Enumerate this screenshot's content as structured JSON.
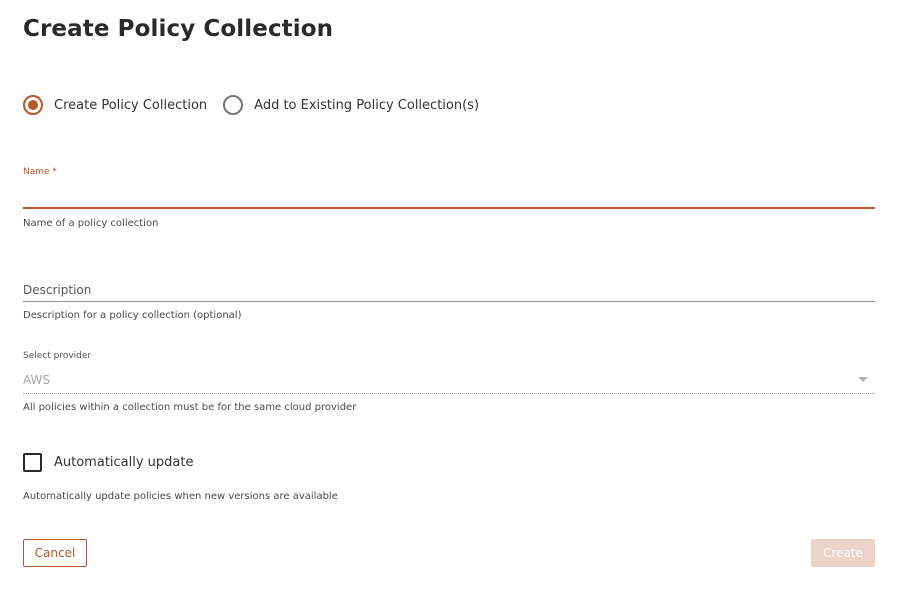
{
  "dialog": {
    "title": "Create Policy Collection"
  },
  "mode": {
    "options": [
      {
        "label": "Create Policy Collection",
        "selected": true
      },
      {
        "label": "Add to Existing Policy Collection(s)",
        "selected": false
      }
    ]
  },
  "name_field": {
    "label": "Name *",
    "value": "",
    "helper": "Name of a policy collection"
  },
  "description_field": {
    "placeholder": "Description",
    "value": "",
    "helper": "Description for a policy collection (optional)"
  },
  "provider_field": {
    "label": "Select provider",
    "value": "AWS",
    "disabled": true,
    "helper": "All policies within a collection must be for the same cloud provider"
  },
  "auto_update": {
    "label": "Automatically update",
    "checked": false,
    "helper": "Automatically update policies when new versions are available"
  },
  "actions": {
    "cancel_label": "Cancel",
    "create_label": "Create",
    "create_disabled": true
  },
  "colors": {
    "accent": "#b5562b",
    "accent_disabled": "#ecd3c8",
    "text": "#2b2b2b"
  }
}
